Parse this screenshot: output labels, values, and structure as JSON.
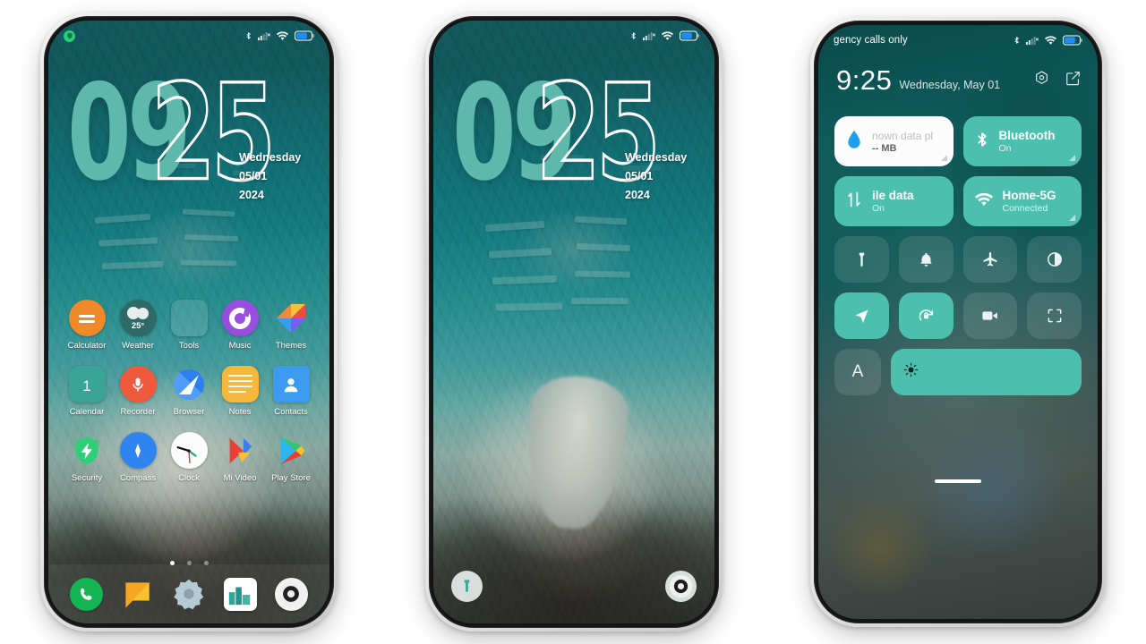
{
  "theme": {
    "accent": "#4cbfae",
    "clock_fill": "#5fb8ac",
    "bg": "#ffffff"
  },
  "phone1": {
    "name": "home-screen",
    "status_bar": {
      "notification_icon": "security-shield-icon",
      "icons": [
        "bluetooth-icon",
        "signal-icon",
        "wifi-icon",
        "battery-icon"
      ]
    },
    "clock": {
      "hours": "09",
      "minutes": "25"
    },
    "date": {
      "weekday": "Wednesday",
      "date": "05/01",
      "year": "2024"
    },
    "apps": [
      [
        {
          "label": "Calculator",
          "icon": "calculator-icon"
        },
        {
          "label": "Weather",
          "icon": "weather-icon",
          "temp": "25°"
        },
        {
          "label": "Tools",
          "icon": "tools-folder-icon"
        },
        {
          "label": "Music",
          "icon": "music-icon"
        },
        {
          "label": "Themes",
          "icon": "themes-icon"
        }
      ],
      [
        {
          "label": "Calendar",
          "icon": "calendar-icon",
          "day": "1"
        },
        {
          "label": "Recorder",
          "icon": "recorder-icon"
        },
        {
          "label": "Browser",
          "icon": "browser-icon"
        },
        {
          "label": "Notes",
          "icon": "notes-icon"
        },
        {
          "label": "Contacts",
          "icon": "contacts-icon"
        }
      ],
      [
        {
          "label": "Security",
          "icon": "security-icon"
        },
        {
          "label": "Compass",
          "icon": "compass-icon"
        },
        {
          "label": "Clock",
          "icon": "clock-icon"
        },
        {
          "label": "Mi Video",
          "icon": "mi-video-icon"
        },
        {
          "label": "Play Store",
          "icon": "play-store-icon"
        }
      ]
    ],
    "page_dots": {
      "count": 3,
      "active": 0
    },
    "dock": [
      {
        "name": "phone-app",
        "icon": "phone-icon"
      },
      {
        "name": "messages-app",
        "icon": "message-icon"
      },
      {
        "name": "settings-app",
        "icon": "gear-icon"
      },
      {
        "name": "gallery-app",
        "icon": "gallery-icon"
      },
      {
        "name": "camera-app",
        "icon": "camera-icon"
      }
    ]
  },
  "phone2": {
    "name": "lock-screen",
    "status_bar": {
      "icons": [
        "bluetooth-icon",
        "signal-icon",
        "wifi-icon",
        "battery-icon"
      ]
    },
    "clock": {
      "hours": "09",
      "minutes": "25"
    },
    "date": {
      "weekday": "Wednesday",
      "date": "05/01",
      "year": "2024"
    },
    "shortcuts": [
      {
        "name": "flashlight-shortcut",
        "icon": "flashlight-icon"
      },
      {
        "name": "camera-shortcut",
        "icon": "camera-icon"
      }
    ]
  },
  "phone3": {
    "name": "control-center",
    "status_bar": {
      "carrier": "gency calls only",
      "icons": [
        "bluetooth-icon",
        "signal-icon",
        "wifi-icon",
        "battery-icon"
      ]
    },
    "header": {
      "time": "9:25",
      "date": "Wednesday, May 01",
      "actions": [
        {
          "name": "settings-button",
          "icon": "hex-gear-icon"
        },
        {
          "name": "edit-button",
          "icon": "edit-icon"
        }
      ]
    },
    "big_tiles": [
      {
        "name": "data-usage-tile",
        "title": "nown data pl",
        "sub": "-- MB",
        "icon": "data-drop-icon",
        "state": "off"
      },
      {
        "name": "bluetooth-tile",
        "title": "Bluetooth",
        "sub": "On",
        "icon": "bluetooth-icon",
        "state": "on"
      },
      {
        "name": "mobile-data-tile",
        "title": "ile data",
        "sub": "On",
        "icon": "mobile-data-icon",
        "state": "on"
      },
      {
        "name": "wifi-tile",
        "title": "Home-5G",
        "sub": "Connected",
        "icon": "wifi-icon",
        "state": "on"
      }
    ],
    "toggles": [
      {
        "name": "flashlight-toggle",
        "icon": "flashlight-icon",
        "state": "off"
      },
      {
        "name": "ringer-toggle",
        "icon": "bell-icon",
        "state": "off"
      },
      {
        "name": "airplane-toggle",
        "icon": "airplane-icon",
        "state": "off"
      },
      {
        "name": "dark-mode-toggle",
        "icon": "contrast-icon",
        "state": "off"
      },
      {
        "name": "location-toggle",
        "icon": "location-arrow-icon",
        "state": "on"
      },
      {
        "name": "rotation-lock-toggle",
        "icon": "rotation-lock-icon",
        "state": "on"
      },
      {
        "name": "screen-recorder-toggle",
        "icon": "video-camera-icon",
        "state": "off"
      },
      {
        "name": "scanner-toggle",
        "icon": "scan-icon",
        "state": "off"
      }
    ],
    "brightness": {
      "auto_label": "A",
      "icon": "sun-icon",
      "level": 100
    }
  }
}
